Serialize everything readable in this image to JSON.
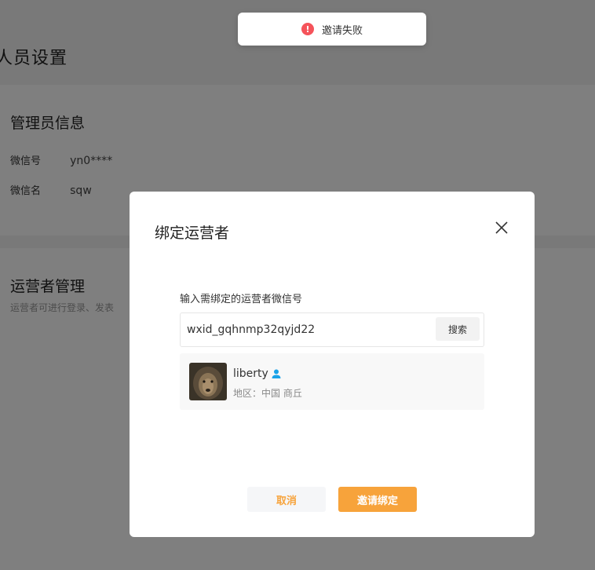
{
  "page": {
    "title": "人员设置",
    "admin_section": {
      "title": "管理员信息",
      "rows": [
        {
          "key": "微信号",
          "value": "yn0****"
        },
        {
          "key": "微信名",
          "value": "sqw"
        }
      ]
    },
    "ops_section": {
      "title": "运营者管理",
      "desc": "运营者可进行登录、发表"
    }
  },
  "toast": {
    "icon": "error-icon",
    "text": "邀请失败",
    "color": "#f5535a"
  },
  "dialog": {
    "title": "绑定运营者",
    "field_label": "输入需绑定的运营者微信号",
    "search_value": "wxid_gqhnmp32qyjd22",
    "search_button": "搜索",
    "result": {
      "name": "liberty",
      "region": "地区：中国 商丘"
    },
    "cancel_label": "取消",
    "invite_label": "邀请绑定",
    "accent_color": "#f7a33b"
  }
}
